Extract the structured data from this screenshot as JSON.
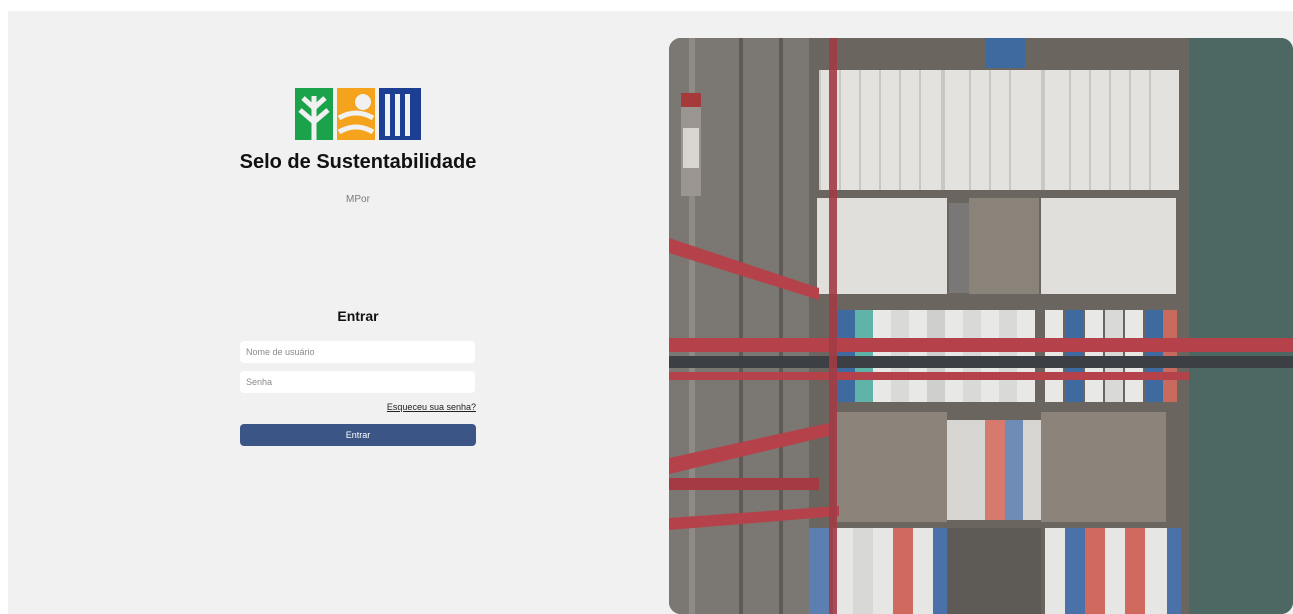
{
  "branding": {
    "title": "Selo de Sustentabilidade",
    "subtitle": "MPor",
    "colors": {
      "green": "#1aa34a",
      "orange": "#f5a21c",
      "navy": "#1c3f94"
    }
  },
  "login": {
    "heading": "Entrar",
    "username_placeholder": "Nome de usuário",
    "password_placeholder": "Senha",
    "forgot_label": "Esqueceu sua senha?",
    "submit_label": "Entrar",
    "button_color": "#3b5587"
  },
  "hero": {
    "icon": "aerial-container-ship-photo"
  }
}
